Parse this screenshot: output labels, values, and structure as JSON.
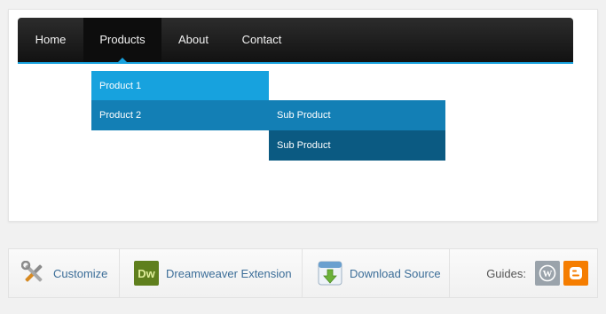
{
  "nav": {
    "items": [
      {
        "label": "Home"
      },
      {
        "label": "Products"
      },
      {
        "label": "About"
      },
      {
        "label": "Contact"
      }
    ],
    "active": "Products",
    "dropdown": [
      {
        "label": "Product 1"
      },
      {
        "label": "Product 2"
      }
    ],
    "submenu": [
      {
        "label": "Sub Product"
      },
      {
        "label": "Sub Product"
      }
    ]
  },
  "footer": {
    "customize": {
      "label": "Customize",
      "icon": "tools-icon"
    },
    "dreamweaver": {
      "label": "Dreamweaver Extension",
      "icon": "dreamweaver-icon",
      "badge": "Dw"
    },
    "download": {
      "label": "Download Source",
      "icon": "download-icon"
    },
    "guides": {
      "label": "Guides:",
      "wordpress_icon": "wordpress-icon",
      "blogger_icon": "blogger-icon"
    }
  },
  "colors": {
    "accent": "#17a2de",
    "dropdown_active": "#137fb5",
    "submenu_active": "#0b5a82",
    "dw_green": "#5f7f1d",
    "blogger_orange": "#f57d00"
  }
}
